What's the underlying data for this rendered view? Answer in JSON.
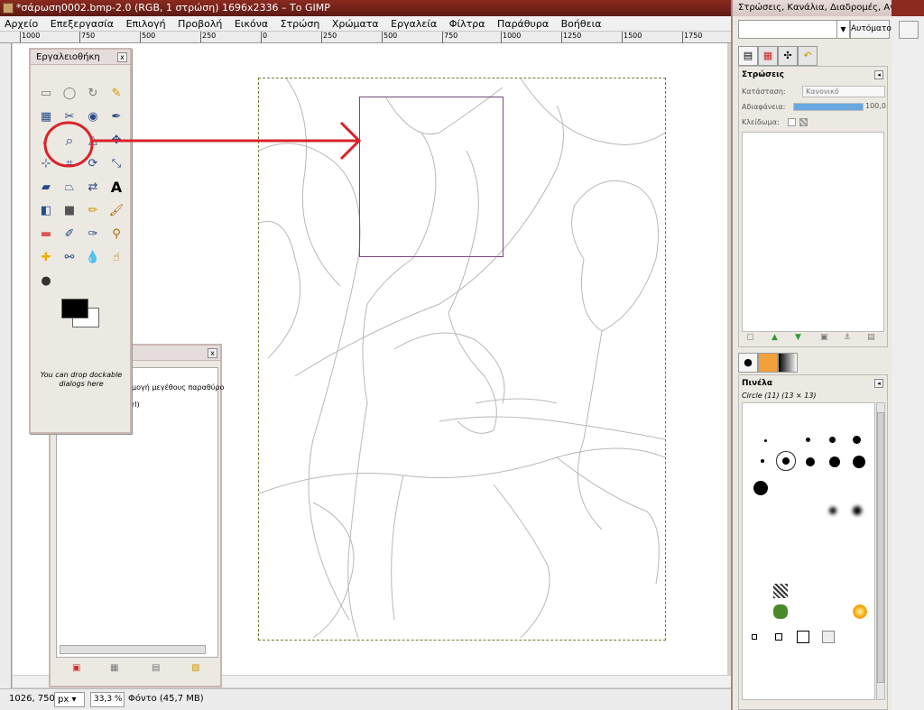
{
  "window": {
    "title": "*σάρωση0002.bmp-2.0 (RGB, 1 στρώση) 1696x2336 – Το GIMP"
  },
  "menu": [
    "Αρχείο",
    "Επεξεργασία",
    "Επιλογή",
    "Προβολή",
    "Εικόνα",
    "Στρώση",
    "Χρώματα",
    "Εργαλεία",
    "Φίλτρα",
    "Παράθυρα",
    "Βοήθεια"
  ],
  "ruler": {
    "ticks": [
      "1000",
      "750",
      "500",
      "250",
      "0",
      "250",
      "500",
      "750",
      "1000",
      "1250",
      "1500",
      "1750"
    ]
  },
  "toolbox": {
    "title": "Εργαλειοθήκη",
    "drop_note": "You can drop dockable dialogs here",
    "tools": [
      "rect-select",
      "ellipse-select",
      "free-select",
      "fuzzy-select",
      "by-color-select",
      "scissors",
      "foreground-select",
      "paths",
      "color-picker",
      "zoom",
      "measure",
      "move",
      "align",
      "crop",
      "rotate",
      "scale",
      "shear",
      "perspective",
      "flip",
      "text",
      "bucket-fill",
      "blend",
      "pencil",
      "paintbrush",
      "eraser",
      "airbrush",
      "ink",
      "clone",
      "heal",
      "perspective-clone",
      "blur",
      "smudge",
      "dodge-burn"
    ],
    "fg_color": "#000000",
    "bg_color": "#ffffff"
  },
  "dock2": {
    "line1": "μογή μεγέθους παραθύρο",
    "line2": "rl)"
  },
  "status": {
    "coords": "1026, 750",
    "unit": "px",
    "zoom": "33,3 %",
    "text": "Φόντο (45,7 MB)"
  },
  "rightdock": {
    "title": "Στρώσεις, Κανάλια, Διαδρομές, Αν...",
    "auto_label": "Αυτόματο",
    "layers": {
      "title": "Στρώσεις",
      "mode_label": "Κατάσταση:",
      "mode_value": "Κανονικό",
      "opacity_label": "Αδιαφάνεια:",
      "opacity_value": "100,0",
      "opacity_fraction": 1.0,
      "lock_label": "Κλείδωμα:"
    },
    "brushes": {
      "title": "Πινέλα",
      "selected": "Circle (11) (13 × 13)"
    }
  },
  "colors": {
    "accent_red": "#d8232a",
    "title_bg": "#8b2a1f"
  }
}
